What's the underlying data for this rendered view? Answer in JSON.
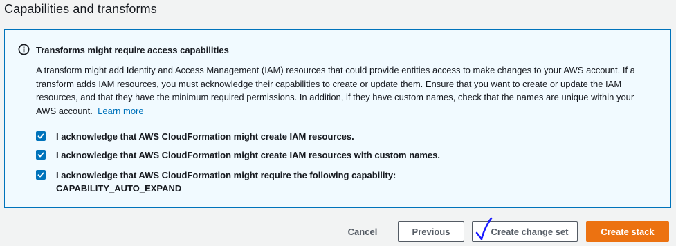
{
  "section": {
    "title": "Capabilities and transforms"
  },
  "alert": {
    "title": "Transforms might require access capabilities",
    "body": "A transform might add Identity and Access Management (IAM) resources that could provide entities access to make changes to your AWS account. If a transform adds IAM resources, you must acknowledge their capabilities to create or update them. Ensure that you want to create or update the IAM resources, and that they have the minimum required permissions. In addition, if they have custom names, check that the names are unique within your AWS account.",
    "learn_more": "Learn more",
    "icon": "info-circle-icon"
  },
  "acknowledgements": [
    {
      "label": "I acknowledge that AWS CloudFormation might create IAM resources.",
      "checked": true
    },
    {
      "label": "I acknowledge that AWS CloudFormation might create IAM resources with custom names.",
      "checked": true
    },
    {
      "label_line1": "I acknowledge that AWS CloudFormation might require the following capability:",
      "label_line2": "CAPABILITY_AUTO_EXPAND",
      "checked": true
    }
  ],
  "buttons": {
    "cancel": "Cancel",
    "previous": "Previous",
    "create_change_set": "Create change set",
    "create_stack": "Create stack"
  },
  "colors": {
    "accent": "#0073bb",
    "primary_button": "#ec7211",
    "alert_bg": "#f1faff",
    "page_bg": "#f2f3f3"
  }
}
